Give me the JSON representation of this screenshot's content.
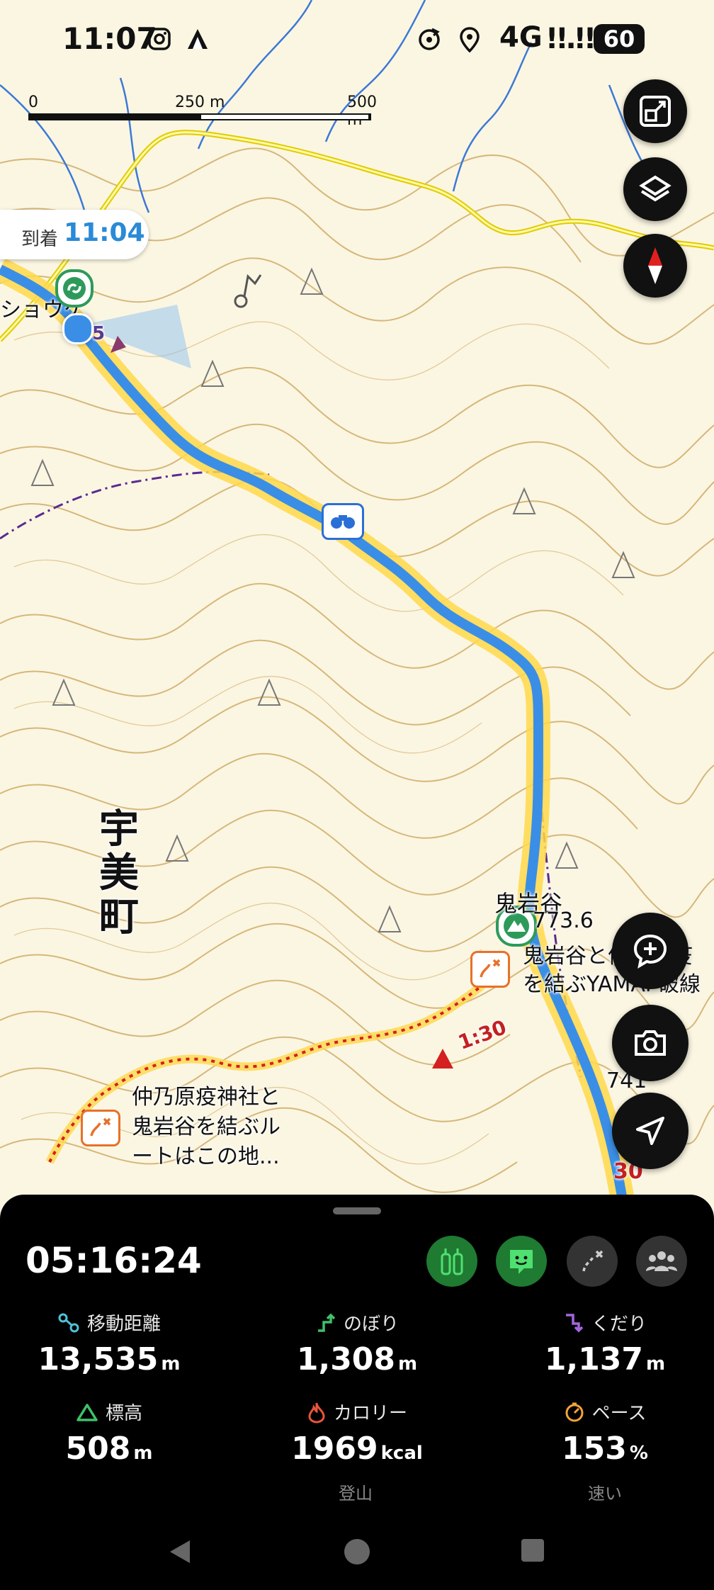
{
  "status_bar": {
    "time": "11:07",
    "network": "4G",
    "signal": "!!.!!",
    "battery": "60",
    "icons": [
      "instagram-icon",
      "app-notification-icon",
      "rotation-icon",
      "location-icon"
    ]
  },
  "map": {
    "scale": {
      "label_0": "0",
      "label_mid": "250 m",
      "label_end": "500 m"
    },
    "arrival": {
      "label": "到着",
      "time": "11:04"
    },
    "place_label": "ショウケ",
    "town_name": "宇美町",
    "peak": {
      "name": "鬼岩谷",
      "elevation": "773.6"
    },
    "spot_elevation": "741",
    "route_numbers": {
      "n1": "5",
      "n2": "1:30",
      "n3": "30"
    },
    "notes": {
      "note_right": "鬼岩谷と仲乃原疫\nを結ぶYAMAP破線",
      "note_left": "仲乃原疫神社と\n鬼岩谷を結ぶル\nートはこの地..."
    },
    "controls": [
      "map-style-toggle",
      "layers",
      "compass",
      "add-memo",
      "camera",
      "current-location"
    ],
    "colors": {
      "route": "#3a8ee6",
      "route_glow": "#ffd84a",
      "contour": "#c9a25a",
      "road": "#e6d000",
      "river": "#3c79d6",
      "danger": "#d42020"
    }
  },
  "panel": {
    "elapsed_time": "05:16:24",
    "buttons": [
      "gear-check",
      "memo",
      "route-off",
      "group"
    ],
    "stats": [
      {
        "icon": "distance-icon",
        "label": "移動距離",
        "value": "13,535",
        "unit": "m",
        "color": "#4fc3d8"
      },
      {
        "icon": "ascent-icon",
        "label": "のぼり",
        "value": "1,308",
        "unit": "m",
        "color": "#3fc06a"
      },
      {
        "icon": "descent-icon",
        "label": "くだり",
        "value": "1,137",
        "unit": "m",
        "color": "#a466e0"
      },
      {
        "icon": "altitude-icon",
        "label": "標高",
        "value": "508",
        "unit": "m",
        "color": "#3fc06a"
      },
      {
        "icon": "calorie-icon",
        "label": "カロリー",
        "value": "1969",
        "unit": "kcal",
        "color": "#e8553a"
      },
      {
        "icon": "pace-icon",
        "label": "ペース",
        "value": "153",
        "unit": "%",
        "color": "#f2a33a"
      }
    ],
    "calorie_sub": "登山",
    "pace_sub": "速い"
  }
}
